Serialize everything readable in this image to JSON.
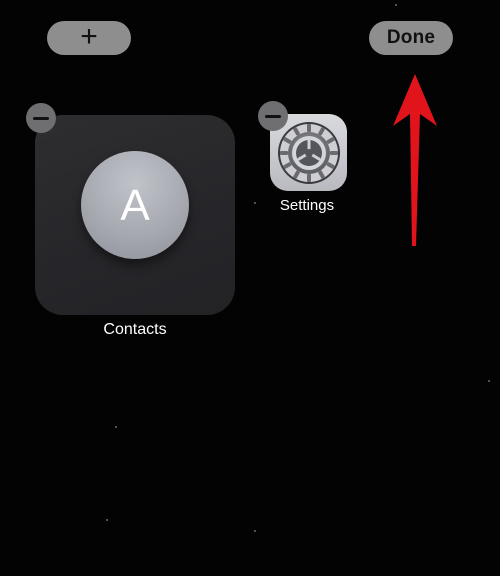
{
  "toolbar": {
    "add_label": "+",
    "done_label": "Done"
  },
  "widgets": {
    "contacts": {
      "avatar_initial": "A",
      "label": "Contacts"
    }
  },
  "apps": {
    "settings": {
      "label": "Settings",
      "icon": "gear-icon"
    }
  },
  "annotation": {
    "arrow_color": "#e0141a",
    "points_to": "done-button"
  },
  "colors": {
    "background": "#030303",
    "pill_button": "#8e8e8e",
    "minus_badge": "#6f6f72"
  }
}
